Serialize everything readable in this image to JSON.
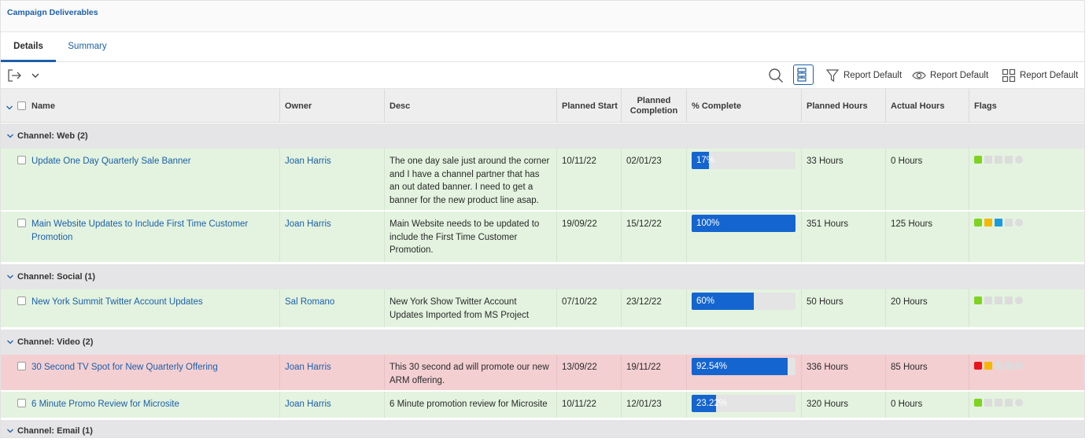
{
  "app": {
    "title": "Campaign Deliverables"
  },
  "tabs": [
    {
      "label": "Details",
      "active": true
    },
    {
      "label": "Summary",
      "active": false
    }
  ],
  "toolbar": {
    "filter_label": "Report Default",
    "view_label": "Report Default",
    "grouping_label": "Report Default"
  },
  "columns": {
    "name": "Name",
    "owner": "Owner",
    "desc": "Desc",
    "planned_start": "Planned Start",
    "planned_completion_line1": "Planned",
    "planned_completion_line2": "Completion",
    "percent_complete": "% Complete",
    "planned_hours": "Planned Hours",
    "actual_hours": "Actual Hours",
    "flags": "Flags"
  },
  "groups": [
    {
      "label": "Channel: Web (2)"
    },
    {
      "label": "Channel: Social (1)"
    },
    {
      "label": "Channel: Video (2)"
    },
    {
      "label": "Channel: Email (1)"
    }
  ],
  "rows": [
    {
      "name": "Update One Day Quarterly Sale Banner",
      "owner": "Joan Harris",
      "desc": "The one day sale just around the corner and I have a channel partner that has an out dated banner. I need to get a banner for the new product line asap.",
      "planned_start": "10/11/22",
      "planned_completion": "02/01/23",
      "percent_label": "17%",
      "percent_value": 17,
      "planned_hours": "33 Hours",
      "actual_hours": "0 Hours",
      "status": "green",
      "flags": [
        "#7ed321",
        "#dcdcdc",
        "#dcdcdc",
        "#dcdcdc",
        "#dcdcdc"
      ]
    },
    {
      "name": "Main Website Updates to Include First Time Customer Promotion",
      "owner": "Joan Harris",
      "desc": "Main Website needs to be updated to include the First Time Customer Promotion.",
      "planned_start": "19/09/22",
      "planned_completion": "15/12/22",
      "percent_label": "100%",
      "percent_value": 100,
      "planned_hours": "351 Hours",
      "actual_hours": "125 Hours",
      "status": "green",
      "flags": [
        "#7ed321",
        "#f5b800",
        "#1a9be0",
        "#dcdcdc",
        "#dcdcdc"
      ]
    },
    {
      "name": "New York Summit Twitter Account Updates",
      "owner": "Sal Romano",
      "desc": "New York Show Twitter Account Updates Imported from MS Project",
      "planned_start": "07/10/22",
      "planned_completion": "23/12/22",
      "percent_label": "60%",
      "percent_value": 60,
      "planned_hours": "50 Hours",
      "actual_hours": "20 Hours",
      "status": "green",
      "flags": [
        "#7ed321",
        "#dcdcdc",
        "#dcdcdc",
        "#dcdcdc",
        "#dcdcdc"
      ]
    },
    {
      "name": "30 Second TV Spot for New Quarterly Offering",
      "owner": "Joan Harris",
      "desc": "This 30 second ad will promote our new ARM offering.",
      "planned_start": "13/09/22",
      "planned_completion": "19/11/22",
      "percent_label": "92.54%",
      "percent_value": 92.54,
      "planned_hours": "336 Hours",
      "actual_hours": "85 Hours",
      "status": "red",
      "flags": [
        "#e8141c",
        "#f5b800",
        "#dcdcdc",
        "#dcdcdc",
        "#dcdcdc"
      ]
    },
    {
      "name": "6 Minute Promo Review for Microsite",
      "owner": "Joan Harris",
      "desc": "6 Minute promotion review for Microsite",
      "planned_start": "10/11/22",
      "planned_completion": "12/01/23",
      "percent_label": "23.22%",
      "percent_value": 23.22,
      "planned_hours": "320 Hours",
      "actual_hours": "0 Hours",
      "status": "green",
      "flags": [
        "#7ed321",
        "#dcdcdc",
        "#dcdcdc",
        "#dcdcdc",
        "#dcdcdc"
      ]
    }
  ]
}
